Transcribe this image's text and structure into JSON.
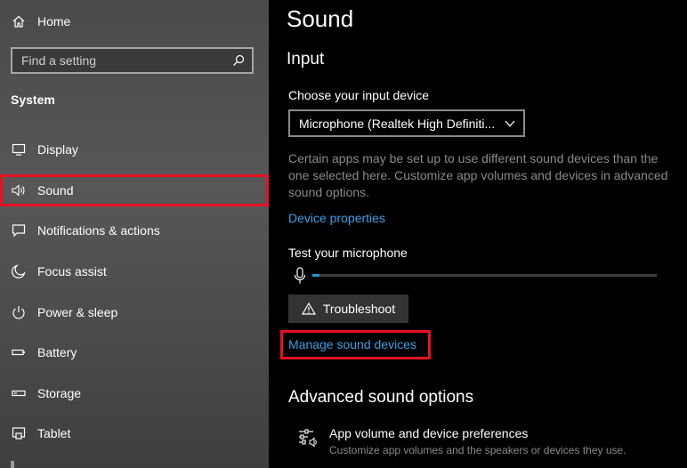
{
  "sidebar": {
    "home_label": "Home",
    "search_placeholder": "Find a setting",
    "section_heading": "System",
    "items": [
      {
        "label": "Display",
        "icon": "display-icon"
      },
      {
        "label": "Sound",
        "icon": "speaker-icon",
        "highlighted": true
      },
      {
        "label": "Notifications & actions",
        "icon": "notifications-icon"
      },
      {
        "label": "Focus assist",
        "icon": "moon-icon"
      },
      {
        "label": "Power & sleep",
        "icon": "power-icon"
      },
      {
        "label": "Battery",
        "icon": "battery-icon"
      },
      {
        "label": "Storage",
        "icon": "storage-icon"
      },
      {
        "label": "Tablet",
        "icon": "tablet-icon"
      }
    ]
  },
  "main": {
    "title": "Sound",
    "input_section": {
      "heading": "Input",
      "choose_label": "Choose your input device",
      "selected_device": "Microphone (Realtek High Definiti...",
      "info_text": "Certain apps may be set up to use different sound devices than the one selected here. Customize app volumes and devices in advanced sound options.",
      "device_properties_link": "Device properties",
      "test_label": "Test your microphone",
      "mic_level_fraction": 0.02,
      "troubleshoot_label": "Troubleshoot",
      "manage_devices_link": "Manage sound devices"
    },
    "advanced_section": {
      "heading": "Advanced sound options",
      "app_volume_title": "App volume and device preferences",
      "app_volume_desc": "Customize app volumes and the speakers or devices they use."
    }
  },
  "colors": {
    "accent_link": "#3aa0e6",
    "highlight_border": "#e81123",
    "level_fill": "#2196e0"
  }
}
